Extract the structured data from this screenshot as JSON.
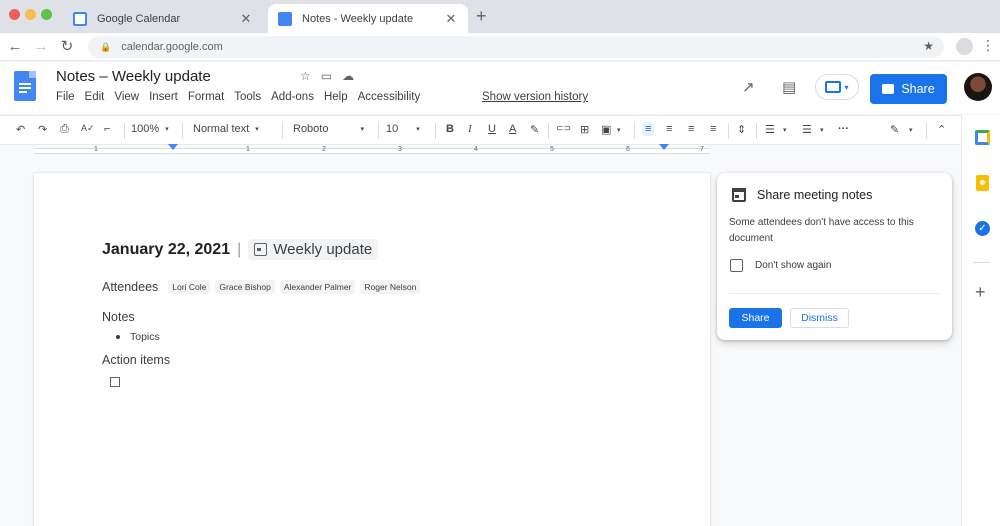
{
  "browser": {
    "tabs": [
      {
        "title": "Google Calendar",
        "close": "✕"
      },
      {
        "title": "Notes - Weekly update",
        "close": "✕"
      }
    ],
    "new_tab": "+",
    "nav": {
      "back": "←",
      "forward": "→",
      "reload": "↻"
    },
    "url": "calendar.google.com",
    "lock": "🔒",
    "star": "★",
    "kebab": "⋮"
  },
  "doc_header": {
    "title": "Notes – Weekly update",
    "title_icons": {
      "star": "☆",
      "folder": "▭",
      "cloud": "☁"
    },
    "menu": [
      "File",
      "Edit",
      "View",
      "Insert",
      "Format",
      "Tools",
      "Add-ons",
      "Help",
      "Accessibility"
    ],
    "version_history": "Show version history",
    "trend_icon": "↗",
    "comment_icon": "▤",
    "present_caret": "▾",
    "share_label": "Share"
  },
  "toolbar": {
    "undo": "↶",
    "redo": "↷",
    "print": "⎙",
    "spellcheck": "A✓",
    "paint_format": "⌐",
    "zoom": "100%",
    "style": "Normal text",
    "font": "Roboto",
    "size": "10",
    "bold": "B",
    "italic": "I",
    "underline": "U",
    "text_color": "A",
    "highlight": "✎",
    "link": "⊂⊃",
    "comment": "⊞",
    "image": "▣",
    "align_left": "≡",
    "align_center": "≡",
    "align_right": "≡",
    "align_justify": "≡",
    "line_spacing": "⇕",
    "checklist": "☰",
    "bulleted_list": "☰",
    "more": "···",
    "edit_mode": "✎",
    "collapse": "⌃",
    "dropdown": "▾"
  },
  "ruler": {
    "numbers": [
      "1",
      "1",
      "2",
      "3",
      "4",
      "5",
      "6",
      "7"
    ]
  },
  "document": {
    "date": "January 22, 2021",
    "separator": "|",
    "event_name": "Weekly update",
    "attendees_label": "Attendees",
    "attendees": [
      "Lori Cole",
      "Grace Bishop",
      "Alexander Palmer",
      "Roger Nelson"
    ],
    "notes_label": "Notes",
    "topics": [
      "Topics"
    ],
    "action_items_label": "Action items"
  },
  "share_card": {
    "title": "Share meeting notes",
    "body": "Some attendees don't have access to this document",
    "checkbox_label": "Don't show again",
    "share_button": "Share",
    "dismiss_button": "Dismiss"
  },
  "side_panel": {
    "tasks_check": "✓",
    "add": "+"
  },
  "colors": {
    "accent": "#1a73e8",
    "docs_blue": "#4285f4",
    "keep_yellow": "#fbbc04"
  }
}
